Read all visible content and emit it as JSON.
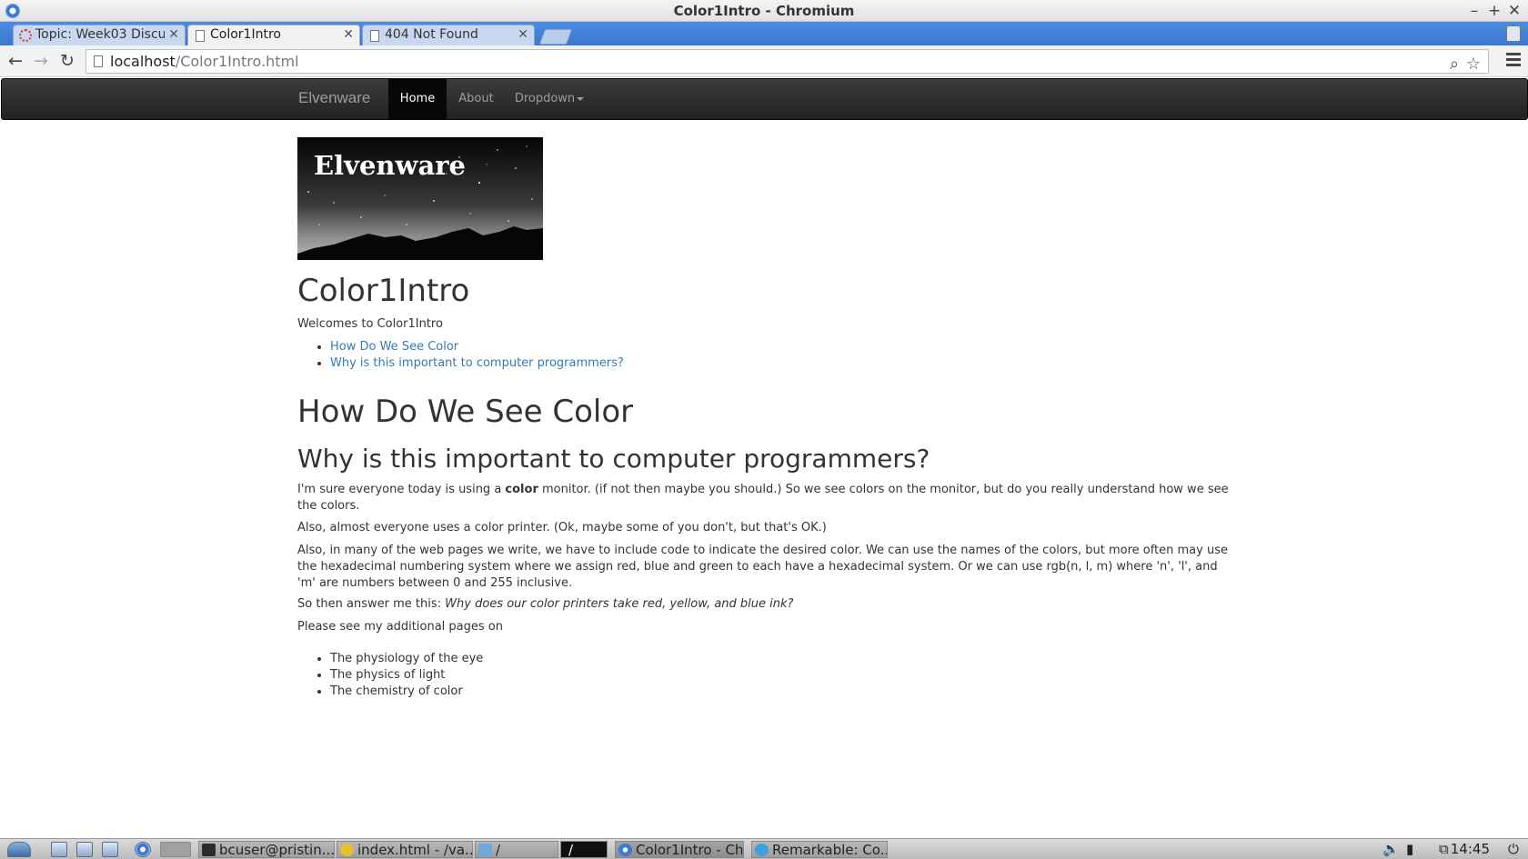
{
  "window": {
    "title": "Color1Intro - Chromium"
  },
  "tabs": [
    {
      "label": "Topic: Week03 Discu",
      "icon": "loading-spinner"
    },
    {
      "label": "Color1Intro",
      "icon": "document-icon"
    },
    {
      "label": "404 Not Found",
      "icon": "document-icon"
    }
  ],
  "toolbar": {
    "url_host": "localhost",
    "url_path": "/Color1Intro.html"
  },
  "navbar": {
    "brand": "Elvenware",
    "items": [
      "Home",
      "About",
      "Dropdown"
    ]
  },
  "content": {
    "banner_text": "Elvenware",
    "title": "Color1Intro",
    "welcome": "Welcomes to Color1Intro",
    "toc": [
      "How Do We See Color",
      "Why is this important to computer programmers?"
    ],
    "heading1": "How Do We See Color",
    "heading2": "Why is this important to computer programmers?",
    "p1_before": "I'm sure everyone today is using a ",
    "p1_bold": "color",
    "p1_after": " monitor. (if not then maybe you should.) So we see colors on the monitor, but do you really understand how we see the colors.",
    "p2": "Also, almost everyone uses a color printer. (Ok, maybe some of you don't, but that's OK.)",
    "p3": "Also, in many of the web pages we write, we have to include code to indicate the desired color. We can use the names of the colors, but more often may use the hexadecimal numbering system where we assign red, blue and green to each have a hexadecimal system. Or we can use rgb(n, l, m) where 'n', 'l', and 'm' are numbers between 0 and 255 inclusive.",
    "p4_before": "So then answer me this: ",
    "p4_italic": "Why does our color printers take red, yellow, and blue ink?",
    "p5": "Please see my additional pages on",
    "pages": [
      "The physiology of the eye",
      "The physics of light",
      "The chemistry of color"
    ]
  },
  "taskbar": {
    "items": [
      "bcuser@pristin...",
      "index.html - /va...",
      "/",
      "/",
      "Color1Intro - Ch...",
      "Remarkable: Co..."
    ],
    "clock": "14:45"
  }
}
